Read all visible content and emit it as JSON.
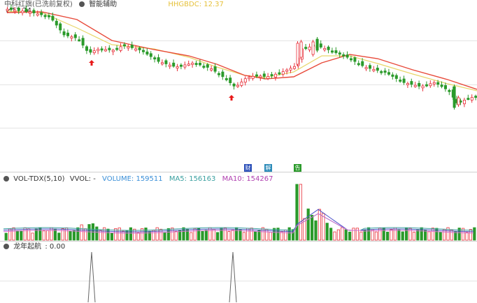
{
  "price_panel": {
    "title": "中科红旗(已洗前复权)",
    "indicator_name": "智能辅助",
    "indicator_value": "HHGBDC: 12.37",
    "high_label": "17.74"
  },
  "volume_panel": {
    "indicator": "VOL-TDX(5,10)",
    "vvol": "VVOL: -",
    "volume": "VOLUME: 159511",
    "ma5": "MA5: 156163",
    "ma10": "MA10: 154267"
  },
  "signal_panel": {
    "indicator": "龙年起航",
    "value": ": 0.00"
  },
  "markers": {
    "m1": "财",
    "m2": "解",
    "m3": "告"
  },
  "colors": {
    "up": "#e8303a",
    "down": "#2a9a2a",
    "ma_red": "#e84a3a",
    "ma_yellow": "#e8d66a",
    "vol_blue": "#4a50c8",
    "vol_teal": "#3aa0a0",
    "vol_pink": "#d26ad2"
  }
}
